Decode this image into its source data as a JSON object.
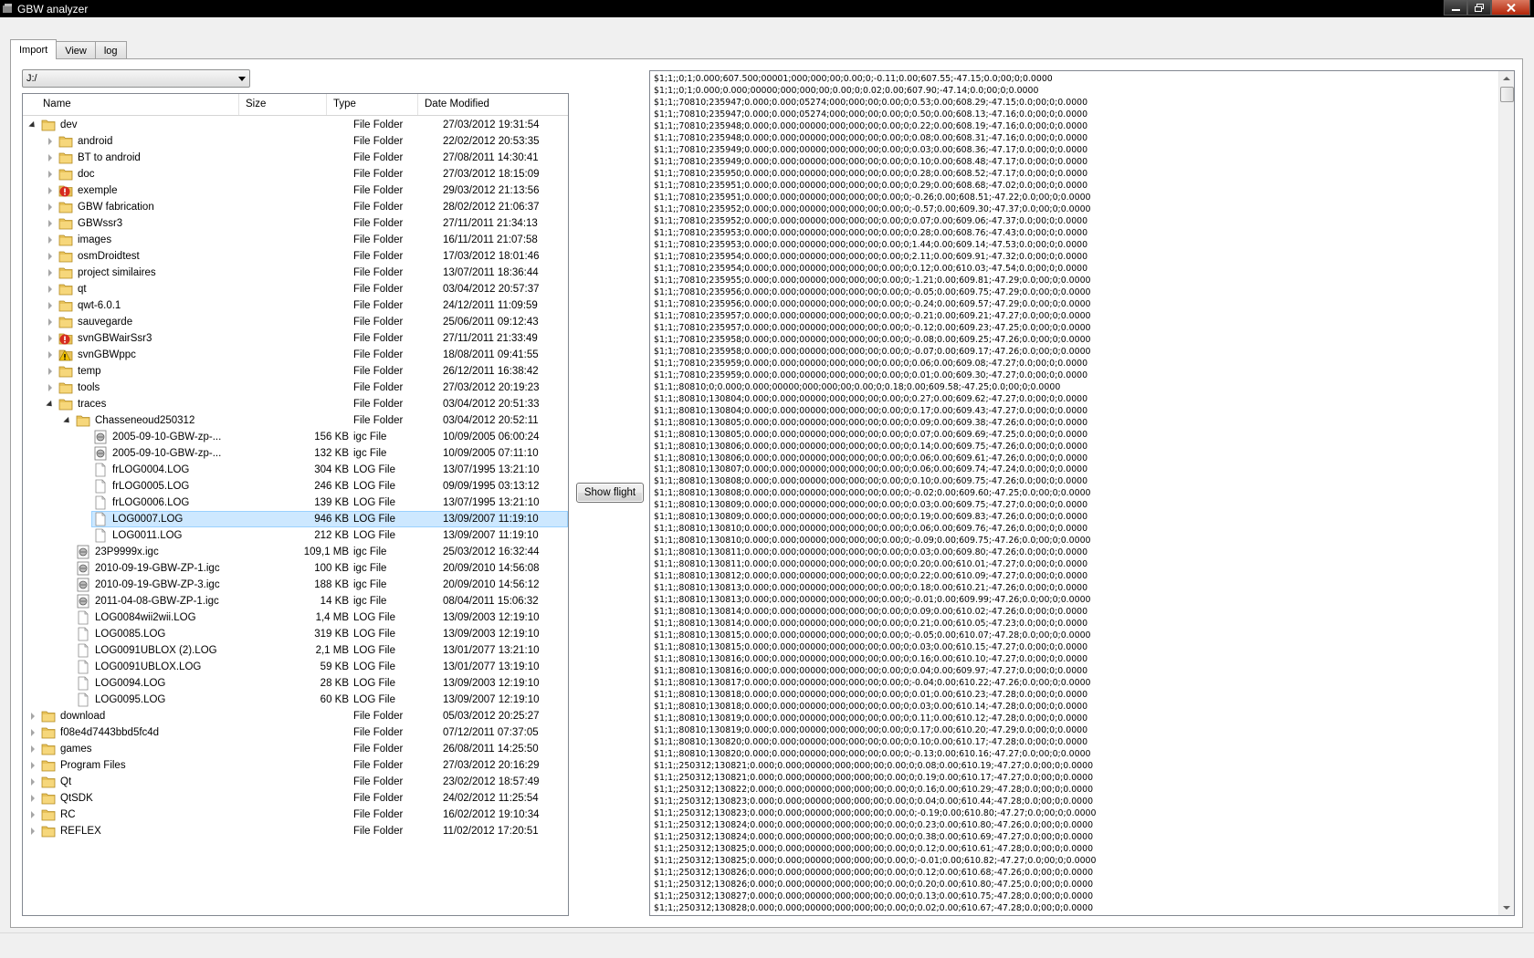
{
  "window": {
    "title": "GBW analyzer"
  },
  "tabs": [
    {
      "label": "Import",
      "active": true
    },
    {
      "label": "View",
      "active": false
    },
    {
      "label": "log",
      "active": false
    }
  ],
  "path_combo": {
    "value": "J:/"
  },
  "tree": {
    "columns": [
      "Name",
      "Size",
      "Type",
      "Date Modified"
    ],
    "rows": [
      {
        "level": 0,
        "expander": "expanded",
        "icon": "folder",
        "name": "dev",
        "size": "",
        "type": "File Folder",
        "date": "27/03/2012 19:31:54"
      },
      {
        "level": 1,
        "expander": "collapsed",
        "icon": "folder",
        "name": "android",
        "size": "",
        "type": "File Folder",
        "date": "22/02/2012 20:53:35"
      },
      {
        "level": 1,
        "expander": "collapsed",
        "icon": "folder",
        "name": "BT to android",
        "size": "",
        "type": "File Folder",
        "date": "27/08/2011 14:30:41"
      },
      {
        "level": 1,
        "expander": "collapsed",
        "icon": "folder",
        "name": "doc",
        "size": "",
        "type": "File Folder",
        "date": "27/03/2012 18:15:09"
      },
      {
        "level": 1,
        "expander": "collapsed",
        "icon": "folder-error",
        "name": "exemple",
        "size": "",
        "type": "File Folder",
        "date": "29/03/2012 21:13:56"
      },
      {
        "level": 1,
        "expander": "collapsed",
        "icon": "folder",
        "name": "GBW fabrication",
        "size": "",
        "type": "File Folder",
        "date": "28/02/2012 21:06:37"
      },
      {
        "level": 1,
        "expander": "collapsed",
        "icon": "folder",
        "name": "GBWssr3",
        "size": "",
        "type": "File Folder",
        "date": "27/11/2011 21:34:13"
      },
      {
        "level": 1,
        "expander": "collapsed",
        "icon": "folder",
        "name": "images",
        "size": "",
        "type": "File Folder",
        "date": "16/11/2011 21:07:58"
      },
      {
        "level": 1,
        "expander": "collapsed",
        "icon": "folder",
        "name": "osmDroidtest",
        "size": "",
        "type": "File Folder",
        "date": "17/03/2012 18:01:46"
      },
      {
        "level": 1,
        "expander": "collapsed",
        "icon": "folder",
        "name": "project similaires",
        "size": "",
        "type": "File Folder",
        "date": "13/07/2011 18:36:44"
      },
      {
        "level": 1,
        "expander": "collapsed",
        "icon": "folder",
        "name": "qt",
        "size": "",
        "type": "File Folder",
        "date": "03/04/2012 20:57:37"
      },
      {
        "level": 1,
        "expander": "collapsed",
        "icon": "folder",
        "name": "qwt-6.0.1",
        "size": "",
        "type": "File Folder",
        "date": "24/12/2011 11:09:59"
      },
      {
        "level": 1,
        "expander": "collapsed",
        "icon": "folder",
        "name": "sauvegarde",
        "size": "",
        "type": "File Folder",
        "date": "25/06/2011 09:12:43"
      },
      {
        "level": 1,
        "expander": "collapsed",
        "icon": "folder-error",
        "name": "svnGBWairSsr3",
        "size": "",
        "type": "File Folder",
        "date": "27/11/2011 21:33:49"
      },
      {
        "level": 1,
        "expander": "collapsed",
        "icon": "folder-warning",
        "name": "svnGBWppc",
        "size": "",
        "type": "File Folder",
        "date": "18/08/2011 09:41:55"
      },
      {
        "level": 1,
        "expander": "collapsed",
        "icon": "folder",
        "name": "temp",
        "size": "",
        "type": "File Folder",
        "date": "26/12/2011 16:38:42"
      },
      {
        "level": 1,
        "expander": "collapsed",
        "icon": "folder",
        "name": "tools",
        "size": "",
        "type": "File Folder",
        "date": "27/03/2012 20:19:23"
      },
      {
        "level": 1,
        "expander": "expanded",
        "icon": "folder",
        "name": "traces",
        "size": "",
        "type": "File Folder",
        "date": "03/04/2012 20:51:33"
      },
      {
        "level": 2,
        "expander": "expanded",
        "icon": "folder",
        "name": "Chasseneoud250312",
        "size": "",
        "type": "File Folder",
        "date": "03/04/2012 20:52:11"
      },
      {
        "level": 3,
        "expander": "",
        "icon": "igc",
        "name": "2005-09-10-GBW-zp-...",
        "size": "156 KB",
        "type": "igc File",
        "date": "10/09/2005 06:00:24"
      },
      {
        "level": 3,
        "expander": "",
        "icon": "igc",
        "name": "2005-09-10-GBW-zp-...",
        "size": "132 KB",
        "type": "igc File",
        "date": "10/09/2005 07:11:10"
      },
      {
        "level": 3,
        "expander": "",
        "icon": "file",
        "name": "frLOG0004.LOG",
        "size": "304 KB",
        "type": "LOG File",
        "date": "13/07/1995 13:21:10"
      },
      {
        "level": 3,
        "expander": "",
        "icon": "file",
        "name": "frLOG0005.LOG",
        "size": "246 KB",
        "type": "LOG File",
        "date": "09/09/1995 03:13:12"
      },
      {
        "level": 3,
        "expander": "",
        "icon": "file",
        "name": "frLOG0006.LOG",
        "size": "139 KB",
        "type": "LOG File",
        "date": "13/07/1995 13:21:10"
      },
      {
        "level": 3,
        "expander": "",
        "icon": "file",
        "name": "LOG0007.LOG",
        "size": "946 KB",
        "type": "LOG File",
        "date": "13/09/2007 11:19:10",
        "selected": true
      },
      {
        "level": 3,
        "expander": "",
        "icon": "file",
        "name": "LOG0011.LOG",
        "size": "212 KB",
        "type": "LOG File",
        "date": "13/09/2007 11:19:10"
      },
      {
        "level": 2,
        "expander": "",
        "icon": "igc",
        "name": "23P9999x.igc",
        "size": "109,1 MB",
        "type": "igc File",
        "date": "25/03/2012 16:32:44"
      },
      {
        "level": 2,
        "expander": "",
        "icon": "igc",
        "name": "2010-09-19-GBW-ZP-1.igc",
        "size": "100 KB",
        "type": "igc File",
        "date": "20/09/2010 14:56:08"
      },
      {
        "level": 2,
        "expander": "",
        "icon": "igc",
        "name": "2010-09-19-GBW-ZP-3.igc",
        "size": "188 KB",
        "type": "igc File",
        "date": "20/09/2010 14:56:12"
      },
      {
        "level": 2,
        "expander": "",
        "icon": "igc",
        "name": "2011-04-08-GBW-ZP-1.igc",
        "size": "14 KB",
        "type": "igc File",
        "date": "08/04/2011 15:06:32"
      },
      {
        "level": 2,
        "expander": "",
        "icon": "file",
        "name": "LOG0084wii2wii.LOG",
        "size": "1,4 MB",
        "type": "LOG File",
        "date": "13/09/2003 12:19:10"
      },
      {
        "level": 2,
        "expander": "",
        "icon": "file",
        "name": "LOG0085.LOG",
        "size": "319 KB",
        "type": "LOG File",
        "date": "13/09/2003 12:19:10"
      },
      {
        "level": 2,
        "expander": "",
        "icon": "file",
        "name": "LOG0091UBLOX (2).LOG",
        "size": "2,1 MB",
        "type": "LOG File",
        "date": "13/01/2077 13:21:10"
      },
      {
        "level": 2,
        "expander": "",
        "icon": "file",
        "name": "LOG0091UBLOX.LOG",
        "size": "59 KB",
        "type": "LOG File",
        "date": "13/01/2077 13:19:10"
      },
      {
        "level": 2,
        "expander": "",
        "icon": "file",
        "name": "LOG0094.LOG",
        "size": "28 KB",
        "type": "LOG File",
        "date": "13/09/2003 12:19:10"
      },
      {
        "level": 2,
        "expander": "",
        "icon": "file",
        "name": "LOG0095.LOG",
        "size": "60 KB",
        "type": "LOG File",
        "date": "13/09/2007 12:19:10"
      },
      {
        "level": 0,
        "expander": "collapsed",
        "icon": "folder",
        "name": "download",
        "size": "",
        "type": "File Folder",
        "date": "05/03/2012 20:25:27"
      },
      {
        "level": 0,
        "expander": "collapsed",
        "icon": "folder",
        "name": "f08e4d7443bbd5fc4d",
        "size": "",
        "type": "File Folder",
        "date": "07/12/2011 07:37:05"
      },
      {
        "level": 0,
        "expander": "collapsed",
        "icon": "folder",
        "name": "games",
        "size": "",
        "type": "File Folder",
        "date": "26/08/2011 14:25:50"
      },
      {
        "level": 0,
        "expander": "collapsed",
        "icon": "folder",
        "name": "Program Files",
        "size": "",
        "type": "File Folder",
        "date": "27/03/2012 20:16:29"
      },
      {
        "level": 0,
        "expander": "collapsed",
        "icon": "folder",
        "name": "Qt",
        "size": "",
        "type": "File Folder",
        "date": "23/02/2012 18:57:49"
      },
      {
        "level": 0,
        "expander": "collapsed",
        "icon": "folder",
        "name": "QtSDK",
        "size": "",
        "type": "File Folder",
        "date": "24/02/2012 11:25:54"
      },
      {
        "level": 0,
        "expander": "collapsed",
        "icon": "folder",
        "name": "RC",
        "size": "",
        "type": "File Folder",
        "date": "16/02/2012 19:10:34"
      },
      {
        "level": 0,
        "expander": "collapsed",
        "icon": "folder",
        "name": "REFLEX",
        "size": "",
        "type": "File Folder",
        "date": "11/02/2012 17:20:51"
      }
    ]
  },
  "show_flight_button": {
    "label": "Show flight"
  },
  "log_view": {
    "lines": [
      "$1;1;;0;1;0.000;607.500;00001;000;000;00;0.00;0;-0.11;0.00;607.55;-47.15;0.0;00;0;0.0000",
      "$1;1;;0;1;0.000;0.000;00000;000;000;00;0.00;0;0.02;0.00;607.90;-47.14;0.0;00;0;0.0000",
      "$1;1;;70810;235947;0.000;0.000;05274;000;000;00;0.00;0;0.53;0.00;608.29;-47.15;0.0;00;0;0.0000",
      "$1;1;;70810;235947;0.000;0.000;05274;000;000;00;0.00;0;0.50;0.00;608.13;-47.16;0.0;00;0;0.0000",
      "$1;1;;70810;235948;0.000;0.000;00000;000;000;00;0.00;0;0.22;0.00;608.19;-47.16;0.0;00;0;0.0000",
      "$1;1;;70810;235948;0.000;0.000;00000;000;000;00;0.00;0;0.08;0.00;608.31;-47.16;0.0;00;0;0.0000",
      "$1;1;;70810;235949;0.000;0.000;00000;000;000;00;0.00;0;0.03;0.00;608.36;-47.17;0.0;00;0;0.0000",
      "$1;1;;70810;235949;0.000;0.000;00000;000;000;00;0.00;0;0.10;0.00;608.48;-47.17;0.0;00;0;0.0000",
      "$1;1;;70810;235950;0.000;0.000;00000;000;000;00;0.00;0;0.28;0.00;608.52;-47.17;0.0;00;0;0.0000",
      "$1;1;;70810;235951;0.000;0.000;00000;000;000;00;0.00;0;0.29;0.00;608.68;-47.02;0.0;00;0;0.0000",
      "$1;1;;70810;235951;0.000;0.000;00000;000;000;00;0.00;0;-0.26;0.00;608.51;-47.22;0.0;00;0;0.0000",
      "$1;1;;70810;235952;0.000;0.000;00000;000;000;00;0.00;0;-0.57;0.00;609.30;-47.37;0.0;00;0;0.0000",
      "$1;1;;70810;235952;0.000;0.000;00000;000;000;00;0.00;0;0.07;0.00;609.06;-47.37;0.0;00;0;0.0000",
      "$1;1;;70810;235953;0.000;0.000;00000;000;000;00;0.00;0;0.28;0.00;608.76;-47.43;0.0;00;0;0.0000",
      "$1;1;;70810;235953;0.000;0.000;00000;000;000;00;0.00;0;1.44;0.00;609.14;-47.53;0.0;00;0;0.0000",
      "$1;1;;70810;235954;0.000;0.000;00000;000;000;00;0.00;0;2.11;0.00;609.91;-47.32;0.0;00;0;0.0000",
      "$1;1;;70810;235954;0.000;0.000;00000;000;000;00;0.00;0;0.12;0.00;610.03;-47.54;0.0;00;0;0.0000",
      "$1;1;;70810;235955;0.000;0.000;00000;000;000;00;0.00;0;-1.21;0.00;609.81;-47.29;0.0;00;0;0.0000",
      "$1;1;;70810;235956;0.000;0.000;00000;000;000;00;0.00;0;-0.05;0.00;609.75;-47.29;0.0;00;0;0.0000",
      "$1;1;;70810;235956;0.000;0.000;00000;000;000;00;0.00;0;-0.24;0.00;609.57;-47.29;0.0;00;0;0.0000",
      "$1;1;;70810;235957;0.000;0.000;00000;000;000;00;0.00;0;-0.21;0.00;609.21;-47.27;0.0;00;0;0.0000",
      "$1;1;;70810;235957;0.000;0.000;00000;000;000;00;0.00;0;-0.12;0.00;609.23;-47.25;0.0;00;0;0.0000",
      "$1;1;;70810;235958;0.000;0.000;00000;000;000;00;0.00;0;-0.08;0.00;609.25;-47.26;0.0;00;0;0.0000",
      "$1;1;;70810;235958;0.000;0.000;00000;000;000;00;0.00;0;-0.07;0.00;609.17;-47.26;0.0;00;0;0.0000",
      "$1;1;;70810;235959;0.000;0.000;00000;000;000;00;0.00;0;0.06;0.00;609.08;-47.27;0.0;00;0;0.0000",
      "$1;1;;70810;235959;0.000;0.000;00000;000;000;00;0.00;0;0.01;0.00;609.30;-47.27;0.0;00;0;0.0000",
      "$1;1;;80810;0;0.000;0.000;00000;000;000;00;0.00;0;0.18;0.00;609.58;-47.25;0.0;00;0;0.0000",
      "$1;1;;80810;130804;0.000;0.000;00000;000;000;00;0.00;0;0.27;0.00;609.62;-47.27;0.0;00;0;0.0000",
      "$1;1;;80810;130804;0.000;0.000;00000;000;000;00;0.00;0;0.17;0.00;609.43;-47.27;0.0;00;0;0.0000",
      "$1;1;;80810;130805;0.000;0.000;00000;000;000;00;0.00;0;0.09;0.00;609.38;-47.26;0.0;00;0;0.0000",
      "$1;1;;80810;130805;0.000;0.000;00000;000;000;00;0.00;0;0.07;0.00;609.69;-47.25;0.0;00;0;0.0000",
      "$1;1;;80810;130806;0.000;0.000;00000;000;000;00;0.00;0;0.14;0.00;609.75;-47.26;0.0;00;0;0.0000",
      "$1;1;;80810;130806;0.000;0.000;00000;000;000;00;0.00;0;0.06;0.00;609.61;-47.26;0.0;00;0;0.0000",
      "$1;1;;80810;130807;0.000;0.000;00000;000;000;00;0.00;0;0.06;0.00;609.74;-47.24;0.0;00;0;0.0000",
      "$1;1;;80810;130808;0.000;0.000;00000;000;000;00;0.00;0;0.10;0.00;609.75;-47.26;0.0;00;0;0.0000",
      "$1;1;;80810;130808;0.000;0.000;00000;000;000;00;0.00;0;-0.02;0.00;609.60;-47.25;0.0;00;0;0.0000",
      "$1;1;;80810;130809;0.000;0.000;00000;000;000;00;0.00;0;0.03;0.00;609.75;-47.27;0.0;00;0;0.0000",
      "$1;1;;80810;130809;0.000;0.000;00000;000;000;00;0.00;0;0.19;0.00;609.83;-47.26;0.0;00;0;0.0000",
      "$1;1;;80810;130810;0.000;0.000;00000;000;000;00;0.00;0;0.06;0.00;609.76;-47.26;0.0;00;0;0.0000",
      "$1;1;;80810;130810;0.000;0.000;00000;000;000;00;0.00;0;-0.09;0.00;609.75;-47.26;0.0;00;0;0.0000",
      "$1;1;;80810;130811;0.000;0.000;00000;000;000;00;0.00;0;0.03;0.00;609.80;-47.26;0.0;00;0;0.0000",
      "$1;1;;80810;130811;0.000;0.000;00000;000;000;00;0.00;0;0.20;0.00;610.01;-47.27;0.0;00;0;0.0000",
      "$1;1;;80810;130812;0.000;0.000;00000;000;000;00;0.00;0;0.22;0.00;610.09;-47.27;0.0;00;0;0.0000",
      "$1;1;;80810;130813;0.000;0.000;00000;000;000;00;0.00;0;0.18;0.00;610.21;-47.26;0.0;00;0;0.0000",
      "$1;1;;80810;130813;0.000;0.000;00000;000;000;00;0.00;0;-0.01;0.00;609.99;-47.26;0.0;00;0;0.0000",
      "$1;1;;80810;130814;0.000;0.000;00000;000;000;00;0.00;0;0.09;0.00;610.02;-47.26;0.0;00;0;0.0000",
      "$1;1;;80810;130814;0.000;0.000;00000;000;000;00;0.00;0;0.21;0.00;610.05;-47.23;0.0;00;0;0.0000",
      "$1;1;;80810;130815;0.000;0.000;00000;000;000;00;0.00;0;-0.05;0.00;610.07;-47.28;0.0;00;0;0.0000",
      "$1;1;;80810;130815;0.000;0.000;00000;000;000;00;0.00;0;0.03;0.00;610.15;-47.27;0.0;00;0;0.0000",
      "$1;1;;80810;130816;0.000;0.000;00000;000;000;00;0.00;0;0.16;0.00;610.10;-47.27;0.0;00;0;0.0000",
      "$1;1;;80810;130816;0.000;0.000;00000;000;000;00;0.00;0;0.04;0.00;609.97;-47.27;0.0;00;0;0.0000",
      "$1;1;;80810;130817;0.000;0.000;00000;000;000;00;0.00;0;-0.04;0.00;610.22;-47.26;0.0;00;0;0.0000",
      "$1;1;;80810;130818;0.000;0.000;00000;000;000;00;0.00;0;0.01;0.00;610.23;-47.28;0.0;00;0;0.0000",
      "$1;1;;80810;130818;0.000;0.000;00000;000;000;00;0.00;0;0.03;0.00;610.14;-47.28;0.0;00;0;0.0000",
      "$1;1;;80810;130819;0.000;0.000;00000;000;000;00;0.00;0;0.11;0.00;610.12;-47.28;0.0;00;0;0.0000",
      "$1;1;;80810;130819;0.000;0.000;00000;000;000;00;0.00;0;0.17;0.00;610.20;-47.29;0.0;00;0;0.0000",
      "$1;1;;80810;130820;0.000;0.000;00000;000;000;00;0.00;0;0.10;0.00;610.17;-47.28;0.0;00;0;0.0000",
      "$1;1;;80810;130820;0.000;0.000;00000;000;000;00;0.00;0;-0.13;0.00;610.16;-47.27;0.0;00;0;0.0000",
      "$1;1;;250312;130821;0.000;0.000;00000;000;000;00;0.00;0;0.08;0.00;610.19;-47.27;0.0;00;0;0.0000",
      "$1;1;;250312;130821;0.000;0.000;00000;000;000;00;0.00;0;0.19;0.00;610.17;-47.27;0.0;00;0;0.0000",
      "$1;1;;250312;130822;0.000;0.000;00000;000;000;00;0.00;0;0.16;0.00;610.29;-47.28;0.0;00;0;0.0000",
      "$1;1;;250312;130823;0.000;0.000;00000;000;000;00;0.00;0;0.04;0.00;610.44;-47.28;0.0;00;0;0.0000",
      "$1;1;;250312;130823;0.000;0.000;00000;000;000;00;0.00;0;-0.19;0.00;610.80;-47.27;0.0;00;0;0.0000",
      "$1;1;;250312;130824;0.000;0.000;00000;000;000;00;0.00;0;0.23;0.00;610.80;-47.26;0.0;00;0;0.0000",
      "$1;1;;250312;130824;0.000;0.000;00000;000;000;00;0.00;0;0.38;0.00;610.69;-47.27;0.0;00;0;0.0000",
      "$1;1;;250312;130825;0.000;0.000;00000;000;000;00;0.00;0;0.12;0.00;610.61;-47.28;0.0;00;0;0.0000",
      "$1;1;;250312;130825;0.000;0.000;00000;000;000;00;0.00;0;-0.01;0.00;610.82;-47.27;0.0;00;0;0.0000",
      "$1;1;;250312;130826;0.000;0.000;00000;000;000;00;0.00;0;0.12;0.00;610.68;-47.26;0.0;00;0;0.0000",
      "$1;1;;250312;130826;0.000;0.000;00000;000;000;00;0.00;0;0.20;0.00;610.80;-47.25;0.0;00;0;0.0000",
      "$1;1;;250312;130827;0.000;0.000;00000;000;000;00;0.00;0;0.13;0.00;610.75;-47.28;0.0;00;0;0.0000",
      "$1;1;;250312;130828;0.000;0.000;00000;000;000;00;0.00;0;0.02;0.00;610.67;-47.28;0.0;00;0;0.0000"
    ]
  },
  "colors": {
    "selection": "#cde8ff",
    "folder": "#e8c25a",
    "error": "#d62b1e",
    "warning": "#f2c200"
  }
}
